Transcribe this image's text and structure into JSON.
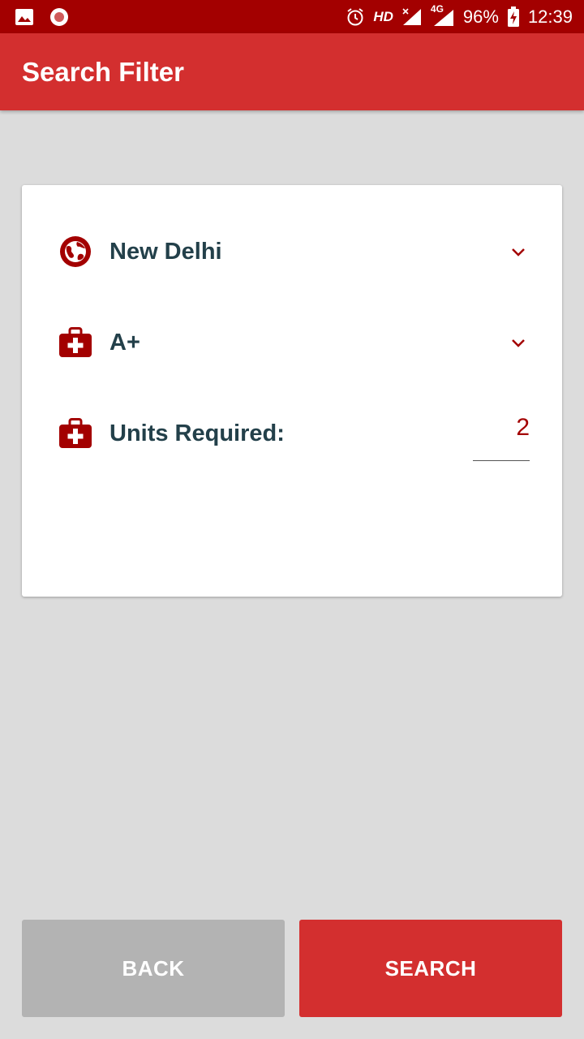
{
  "status_bar": {
    "network": "HD",
    "network_gen": "4G",
    "battery": "96%",
    "time": "12:39",
    "icons": [
      "image-icon",
      "record-icon",
      "alarm-icon",
      "signal-x-icon",
      "signal-4g-icon",
      "battery-charging-icon"
    ]
  },
  "app_bar": {
    "title": "Search Filter"
  },
  "filter": {
    "location": {
      "value": "New Delhi",
      "icon": "globe-icon"
    },
    "blood_group": {
      "value": "A+",
      "icon": "medical-bag-icon"
    },
    "units": {
      "label": "Units Required:",
      "value": "2",
      "icon": "medical-bag-icon"
    }
  },
  "actions": {
    "back_label": "BACK",
    "search_label": "SEARCH"
  },
  "colors": {
    "status_bar": "#a30000",
    "primary": "#d32f2f",
    "accent": "#a30000",
    "text": "#23404a",
    "back_button": "#b3b3b3",
    "background": "#dcdcdc"
  }
}
